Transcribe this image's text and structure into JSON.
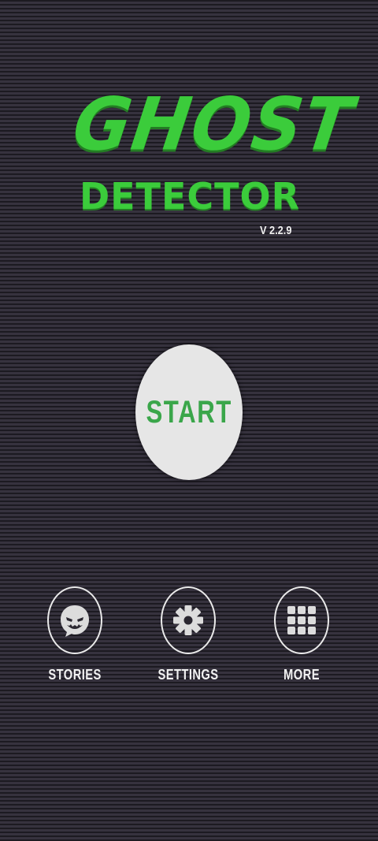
{
  "app": {
    "title_line_1": "GHOST",
    "title_line_2": "DETECTOR",
    "version": "V 2.2.9"
  },
  "main": {
    "start_label": "START"
  },
  "nav": {
    "items": [
      {
        "label": "STORIES",
        "icon": "ghost-face-icon"
      },
      {
        "label": "SETTINGS",
        "icon": "gear-icon"
      },
      {
        "label": "MORE",
        "icon": "grid-icon"
      }
    ]
  },
  "colors": {
    "accent": "#3bcc3b",
    "start_text": "#3aa64a",
    "button_bg": "#e6e6e6",
    "background": "#2a2730",
    "text": "#f2f2f2"
  }
}
